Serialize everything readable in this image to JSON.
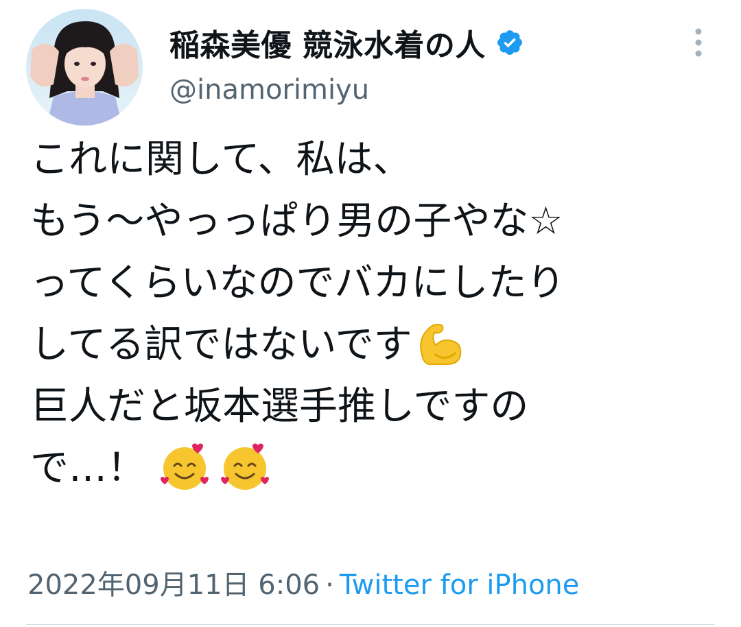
{
  "author": {
    "display_name": "稲森美優 競泳水着の人",
    "handle": "@inamorimiyu",
    "verified_icon": "verified-badge-icon",
    "avatar": "user-avatar-photo"
  },
  "tweet": {
    "lines": [
      "これに関して、私は、",
      "もう〜やっっぱり男の子やな☆",
      "ってくらいなのでバカにしたり",
      "してる訳ではないです",
      "巨人だと坂本選手推しですの",
      "で…！"
    ],
    "emojis": {
      "line4": "flexed-biceps-emoji",
      "line6": [
        "smiling-face-with-hearts-emoji",
        "smiling-face-with-hearts-emoji"
      ]
    }
  },
  "meta": {
    "timestamp": "2022年09月11日 6:06",
    "separator": "·",
    "source": "Twitter for iPhone"
  },
  "colors": {
    "text": "#0f1419",
    "secondary": "#536471",
    "accent": "#1d9bf0"
  }
}
